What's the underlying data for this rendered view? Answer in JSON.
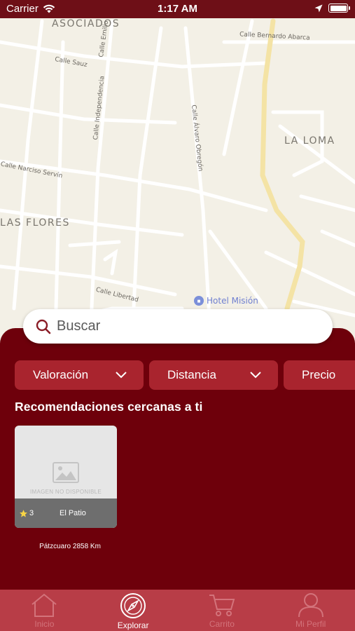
{
  "status_bar": {
    "carrier": "Carrier",
    "time": "1:17 AM"
  },
  "map": {
    "areas": [
      "ASOCIADOS",
      "LA LOMA",
      "LAS FLORES"
    ],
    "streets": [
      "Calle Bernardo Abarca",
      "Calle Sauz",
      "Calle Emilio Carranza",
      "Calle Independencia",
      "Calle Álvaro Obregón",
      "Calle Narciso Servín",
      "Calle Libertad"
    ],
    "poi": "Hotel Misión"
  },
  "search": {
    "placeholder": "Buscar"
  },
  "filters": {
    "rating": "Valoración",
    "distance": "Distancia",
    "price": "Precio"
  },
  "section_title": "Recomendaciones cercanas a ti",
  "card": {
    "placeholder_text": "IMAGEN NO DISPONIBLE",
    "rating": "3",
    "name": "El Patio",
    "caption": "Pátzcuaro  2858 Km"
  },
  "tabs": {
    "home": "Inicio",
    "explore": "Explorar",
    "cart": "Carrito",
    "profile": "Mi Perfil"
  },
  "colors": {
    "primary": "#6e000b",
    "tab_bar": "#b83d47",
    "filter": "#a9242e"
  }
}
